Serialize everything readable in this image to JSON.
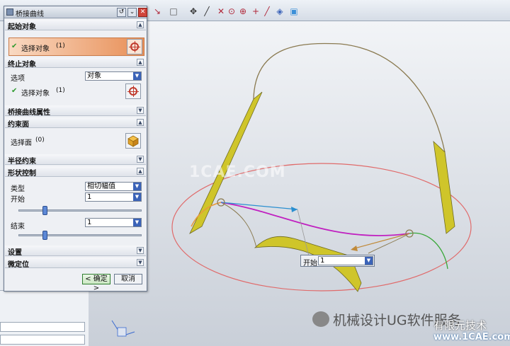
{
  "dialog": {
    "title": "桥接曲线",
    "sections": {
      "start_object": {
        "header": "起始对象",
        "selected_label": "选择对象",
        "selected_count": "(1)"
      },
      "end_object": {
        "header": "终止对象",
        "option_label": "选项",
        "option_value": "对象",
        "selected_label": "选择对象",
        "selected_count": "(1)"
      },
      "bridge_props": {
        "header": "桥接曲线属性"
      },
      "constraint_face": {
        "header": "约束面",
        "select_label": "选择面",
        "select_count": "(0)"
      },
      "radius_constraint": {
        "header": "半径约束"
      },
      "shape_control": {
        "header": "形状控制",
        "type_label": "类型",
        "type_value": "相切幅值",
        "start_label": "开始",
        "start_value": "1",
        "end_label": "结束",
        "end_value": "1",
        "start_slider_fraction": 0.2,
        "end_slider_fraction": 0.2
      },
      "settings": {
        "header": "设置"
      },
      "fine_tune": {
        "header": "微定位"
      }
    },
    "buttons": {
      "ok": "< 确定 >",
      "cancel": "取消"
    }
  },
  "viewport": {
    "watermark": "1CAE.COM",
    "floating_field": {
      "label": "开始",
      "value": "1"
    }
  },
  "overlay": {
    "wechat_text": "机械设计UG软件服务",
    "brand_line1": "有限元技术",
    "brand_line2": "www.1CAE.com"
  },
  "colors": {
    "highlight": "#e88f57",
    "bridge_curve": "#c020c0",
    "ellipse": "#e05050",
    "surface": "#c8c020"
  }
}
